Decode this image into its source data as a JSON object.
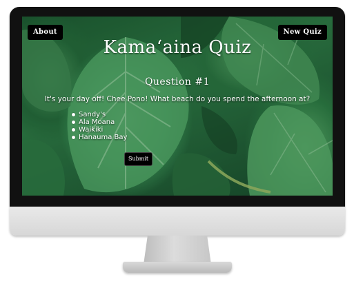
{
  "nav": {
    "about_label": "About",
    "new_quiz_label": "New Quiz"
  },
  "quiz": {
    "title": "Kamaʻaina Quiz",
    "question_number": "Question #1",
    "question_text": "It's your day off! Chee Pono! What beach do you spend the afternoon at?",
    "answers": [
      "Sandy's",
      "Ala Moana",
      "Waikiki",
      "Hanauma Bay"
    ],
    "submit_label": "Submit"
  },
  "colors": {
    "button_bg": "#000000",
    "text": "#ffffff",
    "leaf_green": "#3f9a5c",
    "bezel": "#111111"
  }
}
